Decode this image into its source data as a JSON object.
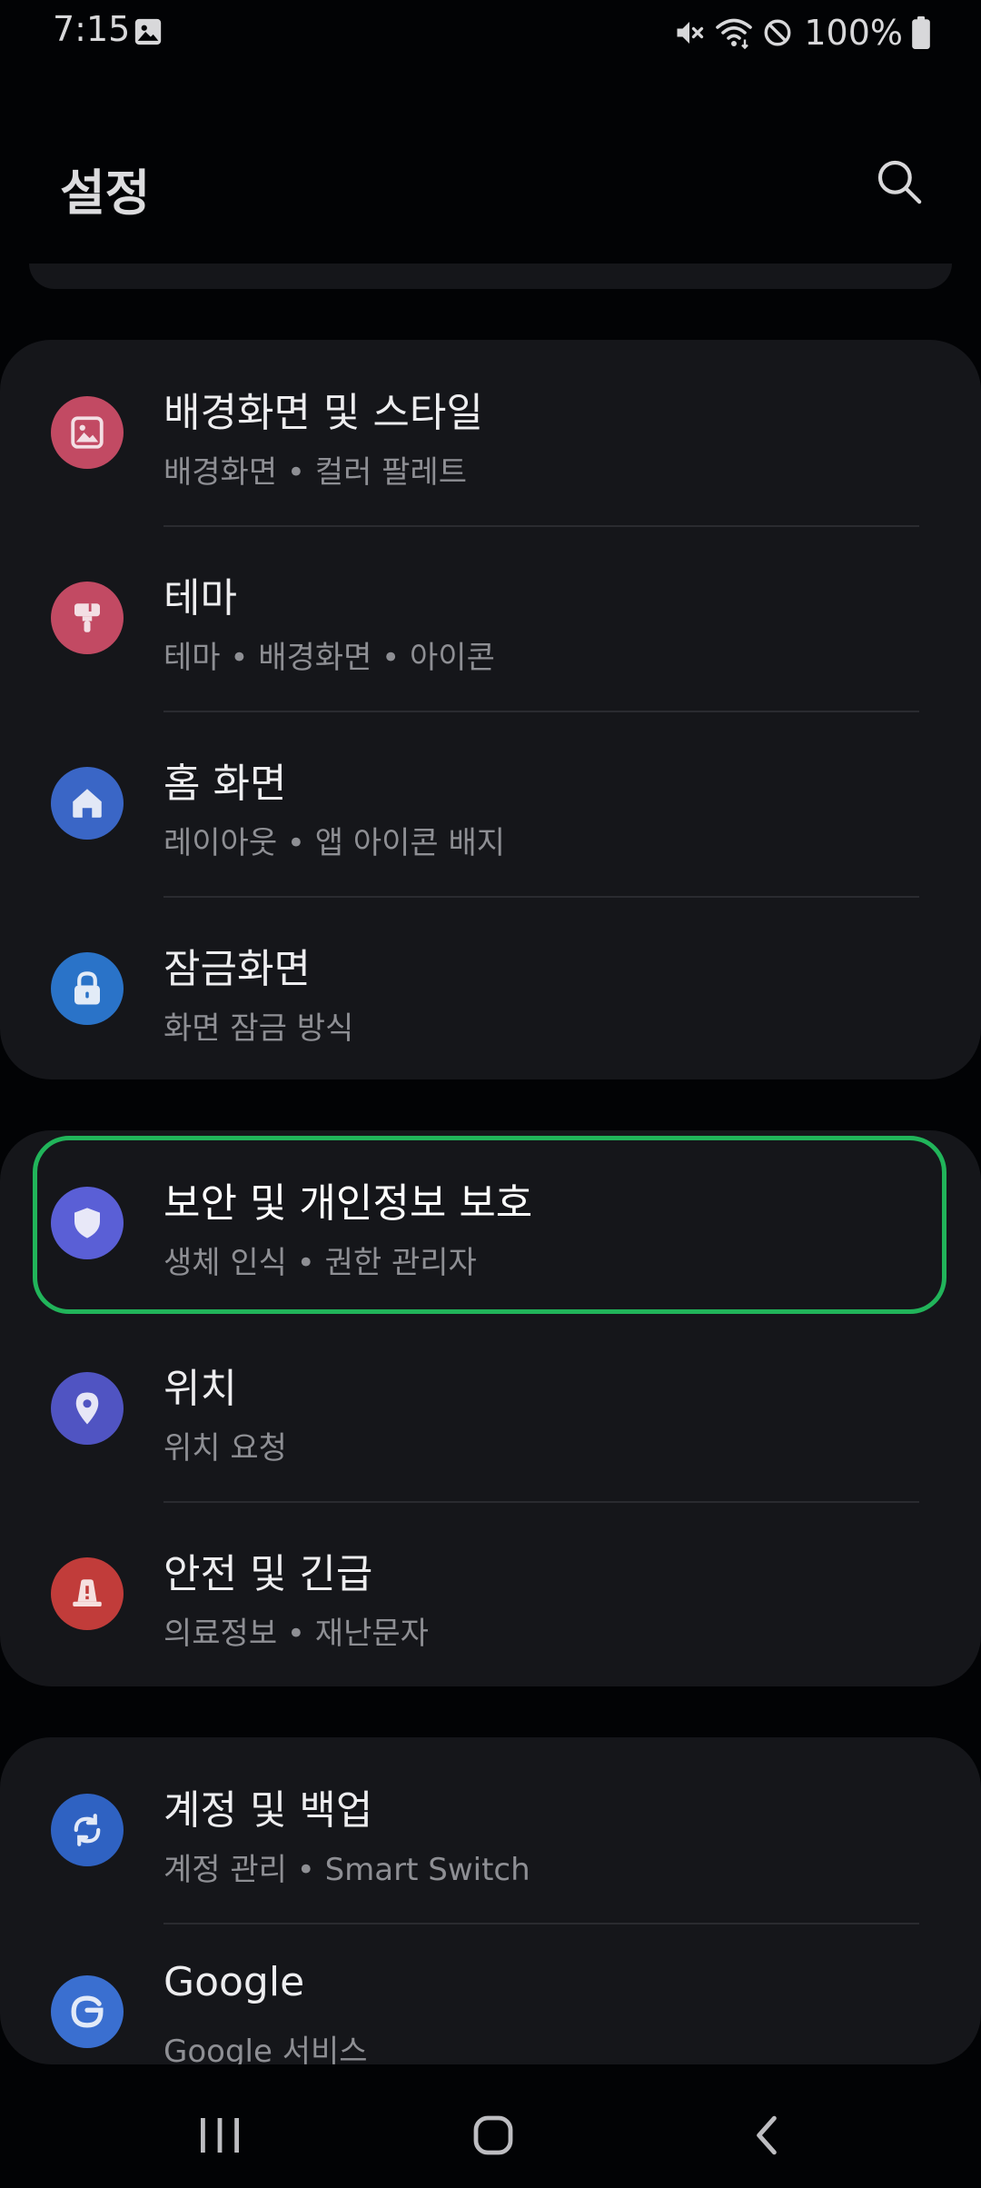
{
  "status_bar": {
    "time": "7:15",
    "battery": "100%",
    "icons": [
      "gallery-icon",
      "mute-icon",
      "wifi-icon",
      "do-not-disturb-icon",
      "battery-icon"
    ]
  },
  "header": {
    "title": "설정",
    "search_icon": "search-icon"
  },
  "groups": [
    {
      "items": [
        {
          "title": "배경화면 및 스타일",
          "subtitle": "배경화면  •  컬러 팔레트",
          "icon": "wallpaper-icon",
          "color": "#c24a63"
        },
        {
          "title": "테마",
          "subtitle": "테마  •  배경화면  •  아이콘",
          "icon": "paintbrush-icon",
          "color": "#c24a63"
        },
        {
          "title": "홈 화면",
          "subtitle": "레이아웃  •  앱 아이콘 배지",
          "icon": "home-icon",
          "color": "#3a66c6"
        },
        {
          "title": "잠금화면",
          "subtitle": "화면 잠금 방식",
          "icon": "lock-icon",
          "color": "#2a73c8"
        }
      ]
    },
    {
      "items": [
        {
          "title": "보안 및 개인정보 보호",
          "subtitle": "생체 인식  •  권한 관리자",
          "icon": "shield-icon",
          "color": "#5a5fd6"
        },
        {
          "title": "위치",
          "subtitle": "위치 요청",
          "icon": "location-icon",
          "color": "#5054c2"
        },
        {
          "title": "안전 및 긴급",
          "subtitle": "의료정보  •  재난문자",
          "icon": "emergency-icon",
          "color": "#c13c3a"
        }
      ]
    },
    {
      "items": [
        {
          "title": "계정 및 백업",
          "subtitle": "계정 관리  •  Smart Switch",
          "icon": "sync-icon",
          "color": "#2f62c2"
        },
        {
          "title": "Google",
          "subtitle": "Google 서비스",
          "icon": "google-icon",
          "color": "#3a6fd0"
        }
      ]
    }
  ],
  "nav_bar": {
    "icons": [
      "recents-icon",
      "home-button-icon",
      "back-icon"
    ]
  },
  "colors": {
    "background": "#020305",
    "card": "#15161a",
    "highlight": "#21b45a"
  }
}
